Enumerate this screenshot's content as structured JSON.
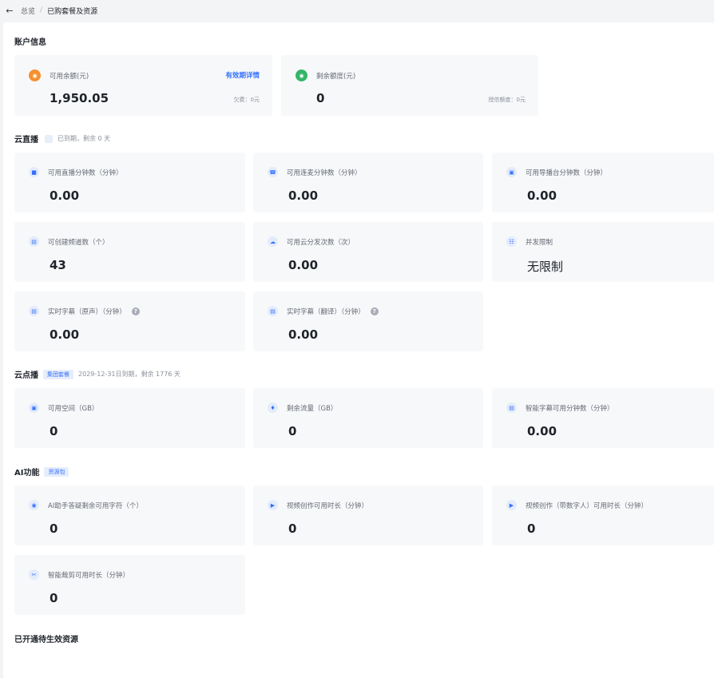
{
  "breadcrumb": {
    "parent": "总览",
    "separator": "/",
    "current": "已购套餐及资源"
  },
  "account": {
    "title": "账户信息",
    "balance": {
      "label": "可用余额(元)",
      "value": "1,950.05",
      "link": "有效期详情",
      "note": "欠费：0元"
    },
    "quota": {
      "label": "剩余额度(元)",
      "value": "0",
      "note": "授信额度：0元"
    }
  },
  "live": {
    "title": "云直播",
    "status": "已到期，剩余 0 天",
    "cards": [
      {
        "label": "可用直播分钟数（分钟）",
        "value": "0.00",
        "icon": "live-icon"
      },
      {
        "label": "可用连麦分钟数（分钟）",
        "value": "0.00",
        "icon": "phone-icon"
      },
      {
        "label": "可用导播台分钟数（分钟）",
        "value": "0.00",
        "icon": "monitor-icon"
      },
      {
        "label": "可创建频道数（个）",
        "value": "43",
        "icon": "channel-icon"
      },
      {
        "label": "可用云分发次数（次）",
        "value": "0.00",
        "icon": "cloud-icon"
      },
      {
        "label": "并发限制",
        "value": "无限制",
        "icon": "network-icon"
      },
      {
        "label": "实时字幕（原声）（分钟）",
        "value": "0.00",
        "icon": "subtitle-icon"
      },
      {
        "label": "实时字幕（翻译）（分钟）",
        "value": "0.00",
        "icon": "subtitle-icon"
      }
    ]
  },
  "vod": {
    "title": "云点播",
    "tag": "集团套餐",
    "status": "2029-12-31日到期，剩余 1776 天",
    "cards": [
      {
        "label": "可用空间（GB）",
        "value": "0",
        "icon": "storage-icon"
      },
      {
        "label": "剩余流量（GB）",
        "value": "0",
        "icon": "traffic-icon"
      },
      {
        "label": "智能字幕可用分钟数（分钟）",
        "value": "0.00",
        "icon": "subtitle-icon"
      }
    ]
  },
  "ai": {
    "title": "AI功能",
    "tag": "资源包",
    "cards": [
      {
        "label": "AI助手答疑剩余可用字符（个）",
        "value": "0",
        "icon": "ai-icon"
      },
      {
        "label": "视频创作可用时长（分钟）",
        "value": "0",
        "icon": "video-icon"
      },
      {
        "label": "视频创作（带数字人）可用时长（分钟）",
        "value": "0",
        "icon": "video-icon"
      },
      {
        "label": "智能裁剪可用时长（分钟）",
        "value": "0",
        "icon": "scissors-icon"
      }
    ]
  },
  "pending": {
    "title": "已开通待生效资源"
  },
  "colors": {
    "accent": "#3370ff",
    "orange": "#f5902f",
    "green": "#33b567",
    "card_bg": "#f7f8fa"
  }
}
